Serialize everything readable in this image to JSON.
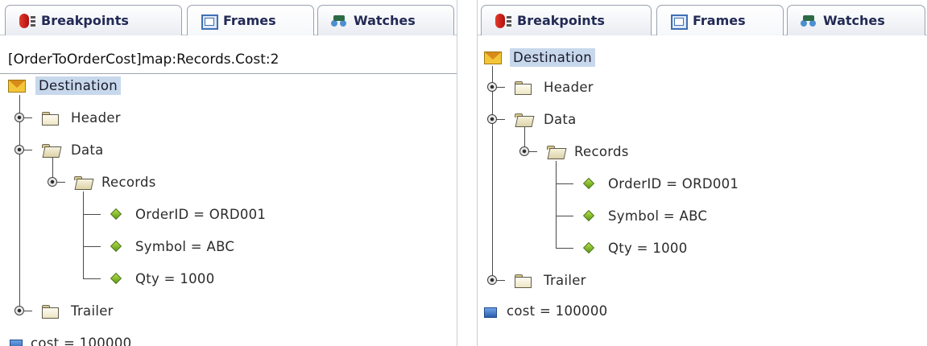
{
  "tabs": [
    {
      "label": "Breakpoints",
      "icon": "breakpoints-icon"
    },
    {
      "label": "Frames",
      "icon": "frames-icon"
    },
    {
      "label": "Watches",
      "icon": "watches-icon"
    }
  ],
  "left_panel": {
    "location": "[OrderToOrderCost]map:Records.Cost:2",
    "tree": {
      "root": "Destination",
      "header": "Header",
      "data": "Data",
      "records": "Records",
      "fields": [
        "OrderID = ORD001",
        "Symbol = ABC",
        "Qty = 1000"
      ],
      "trailer": "Trailer",
      "variable": "cost = 100000"
    }
  },
  "right_panel": {
    "tree": {
      "root": "Destination",
      "header": "Header",
      "data": "Data",
      "records": "Records",
      "fields": [
        "OrderID = ORD001",
        "Symbol = ABC",
        "Qty = 1000"
      ],
      "trailer": "Trailer",
      "variable": "cost = 100000"
    }
  },
  "colors": {
    "selection": "#c8d8ec",
    "tab_text": "#222a55",
    "field_icon": "#7fb82a"
  }
}
